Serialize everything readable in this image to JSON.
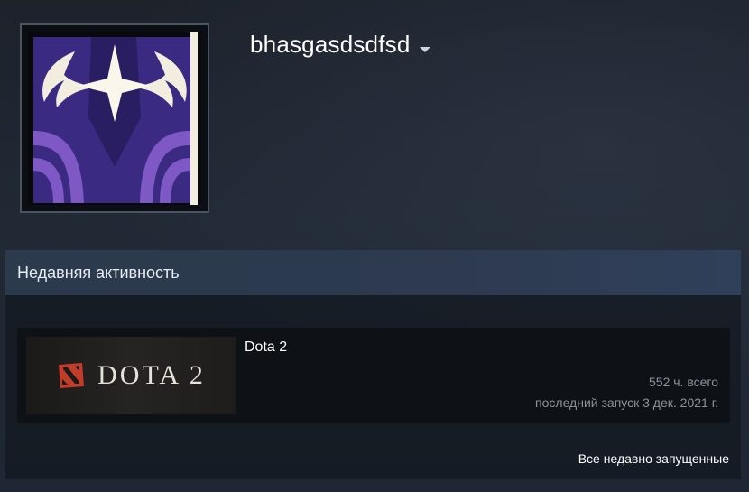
{
  "profile": {
    "persona_name": "bhasgasdsdfsd",
    "avatar_icon": "antlered-star-avatar"
  },
  "recent_activity": {
    "title": "Недавняя активность",
    "games": [
      {
        "name": "Dota 2",
        "capsule_text": "DOTA 2",
        "hours": "552 ч. всего",
        "last_played": "последний запуск 3 дек. 2021 г."
      }
    ],
    "view_all_label": "Все недавно запущенные"
  },
  "colors": {
    "accent_purple": "#3a2a78",
    "header_blue": "#2d3a50",
    "dota_red": "#c23c2a"
  }
}
